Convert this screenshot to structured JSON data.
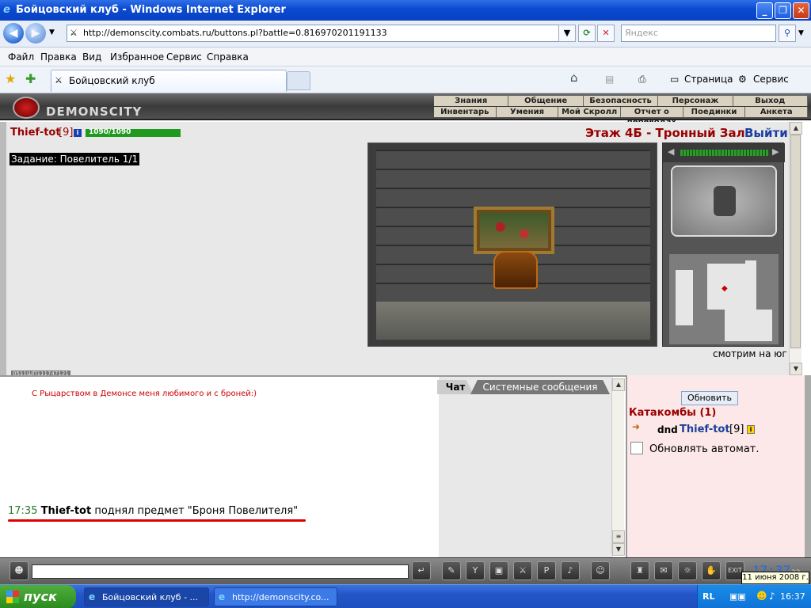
{
  "window": {
    "title": "Бойцовский клуб - Windows Internet Explorer"
  },
  "addressbar": {
    "url": "http://demonscity.combats.ru/buttons.pl?battle=0.816970201191133",
    "search_placeholder": "Яндекс"
  },
  "menubar": {
    "items": [
      "Файл",
      "Правка",
      "Вид",
      "Избранное",
      "Сервис",
      "Справка"
    ]
  },
  "tabs": {
    "active": "Бойцовский клуб"
  },
  "tools": {
    "page": "Страница",
    "service": "Сервис"
  },
  "game": {
    "logo": "DEMONSCITY",
    "nav_top": [
      "Знания",
      "Общение",
      "Безопасность",
      "Персонаж",
      "Выход"
    ],
    "nav_bottom": [
      "Инвентарь",
      "Умения",
      "Мой Скролл",
      "Отчет о переводах",
      "Поединки",
      "Анкета"
    ],
    "player": {
      "name": "Thief-tot",
      "level": "[9]",
      "hp": "1090/1090",
      "hp_fraction": 1.0
    },
    "quest": "Задание: Повелитель 1/1",
    "location": "Этаж 4Б - Тронный Зал",
    "exit": "Выйти",
    "direction": "смотрим на юг",
    "small_counter": "0511ШП111747121"
  },
  "chat": {
    "tab_chat": "Чат",
    "tab_system": "Системные сообщения",
    "header_message": "С Рыцарством в Демонсе меня любимого и с броней:)",
    "log": {
      "time": "17:35",
      "name": "Thief-tot",
      "text": " поднял предмет \"Броня Повелителя\""
    }
  },
  "side": {
    "refresh": "Обновить",
    "room": "Катакомбы (1)",
    "user_prefix": "dnd",
    "user_name": "Thief-tot",
    "user_level": "[9]",
    "auto_refresh": "Обновлять автомат."
  },
  "toolbar_bottom": {
    "clock": "17:37",
    "seconds": "33",
    "date_tooltip": "11 июня 2008 г."
  },
  "taskbar": {
    "start": "пуск",
    "task1": "Бойцовский клуб - ...",
    "task2": "http://demonscity.co...",
    "lang": "RL",
    "time": "16:37"
  }
}
